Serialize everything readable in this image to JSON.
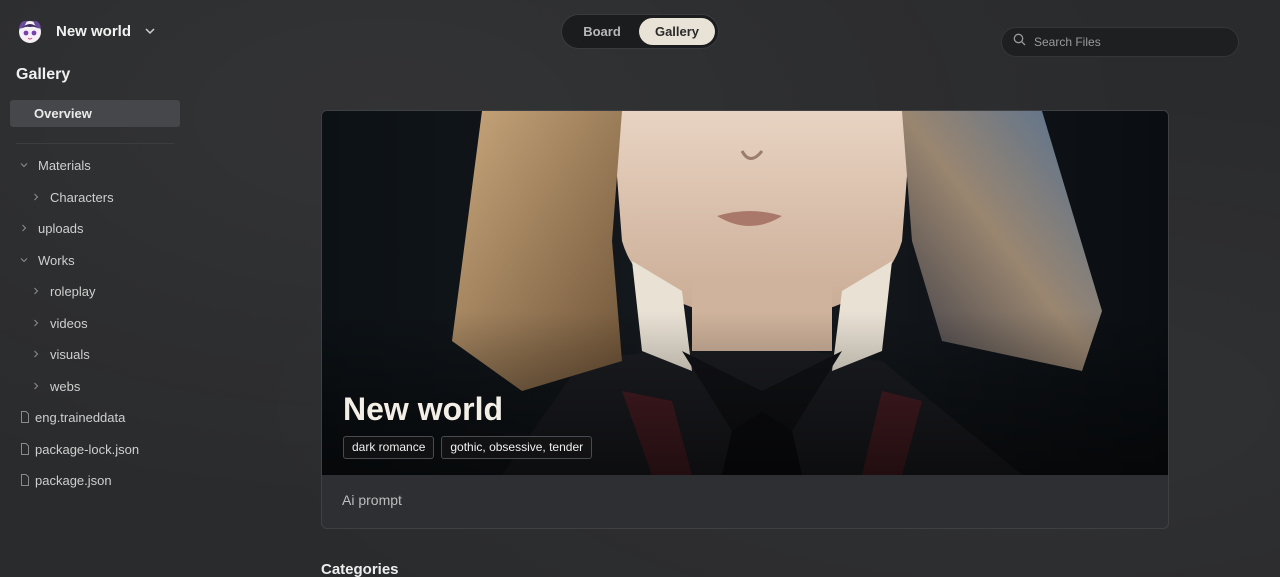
{
  "workspace": {
    "name": "New world",
    "logo_icon": "avatar-logo-icon",
    "dropdown_icon": "chevron-down-icon"
  },
  "sidebar": {
    "title": "Gallery",
    "overview_label": "Overview",
    "tree": [
      {
        "label": "Materials",
        "type": "folder",
        "state": "expanded",
        "depth": 0
      },
      {
        "label": "Characters",
        "type": "folder",
        "state": "collapsed",
        "depth": 1
      },
      {
        "label": "uploads",
        "type": "folder",
        "state": "collapsed",
        "depth": 0
      },
      {
        "label": "Works",
        "type": "folder",
        "state": "expanded",
        "depth": 0
      },
      {
        "label": "roleplay",
        "type": "folder",
        "state": "collapsed",
        "depth": 1
      },
      {
        "label": "videos",
        "type": "folder",
        "state": "collapsed",
        "depth": 1
      },
      {
        "label": "visuals",
        "type": "folder",
        "state": "collapsed",
        "depth": 1
      },
      {
        "label": "webs",
        "type": "folder",
        "state": "collapsed",
        "depth": 1
      },
      {
        "label": "eng.traineddata",
        "type": "file",
        "depth": 0
      },
      {
        "label": "package-lock.json",
        "type": "file",
        "depth": 0
      },
      {
        "label": "package.json",
        "type": "file",
        "depth": 0
      }
    ]
  },
  "view_toggle": {
    "options": [
      "Board",
      "Gallery"
    ],
    "selected": "Gallery"
  },
  "search": {
    "placeholder": "Search Files",
    "icon": "search-icon"
  },
  "card": {
    "title": "New world",
    "tags": [
      "dark romance",
      "gothic, obsessive, tender"
    ],
    "footer": "Ai prompt"
  },
  "section": {
    "title": "Categories"
  },
  "colors": {
    "background": "#2a2b2d",
    "accent_selected": "#e9e2d6",
    "sidebar_selected": "#45474a"
  }
}
